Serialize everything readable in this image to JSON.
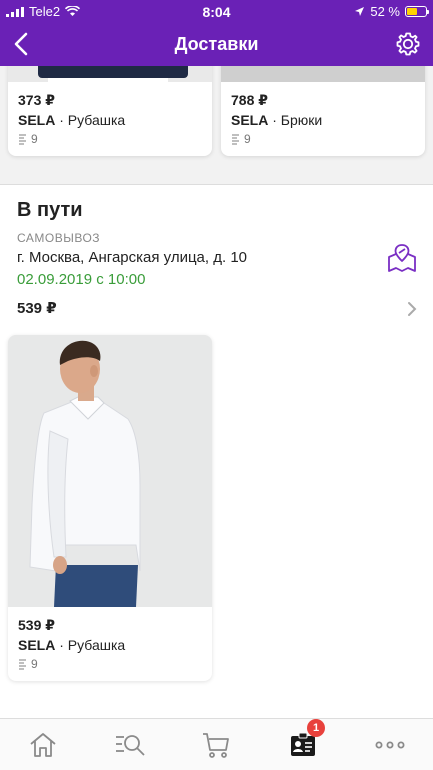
{
  "status_bar": {
    "carrier": "Tele2",
    "time": "8:04",
    "battery": "52 %",
    "battery_level": 0.52
  },
  "header": {
    "title": "Доставки"
  },
  "prev_items": [
    {
      "price": "373 ₽",
      "brand": "SELA",
      "name": "· Рубашка",
      "size": "9"
    },
    {
      "price": "788 ₽",
      "brand": "SELA",
      "name": "· Брюки",
      "size": "9"
    }
  ],
  "delivery": {
    "status": "В пути",
    "type": "САМОВЫВОЗ",
    "address": "г. Москва, Ангарская улица, д. 10",
    "datetime": "02.09.2019 с 10:00",
    "total": "539 ₽",
    "items": [
      {
        "price": "539 ₽",
        "brand": "SELA",
        "name": "· Рубашка",
        "size": "9"
      }
    ]
  },
  "tab_bar": {
    "items": [
      "home-icon",
      "search-icon",
      "cart-icon",
      "orders-icon",
      "more-icon"
    ],
    "orders_badge": "1",
    "accent": "#6a21b6",
    "badge_color": "#e8413c"
  }
}
